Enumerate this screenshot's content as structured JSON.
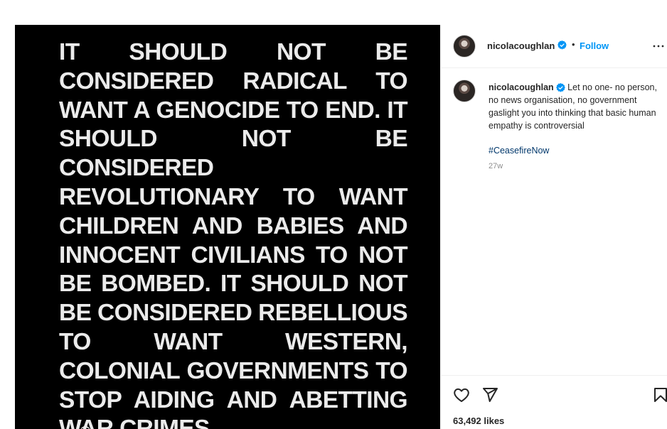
{
  "post": {
    "image_text": "It should not be considered radical to want a genocide to end. It should not be considered revolutionary to want children and babies and innocent civilians to not be bombed. It should not be considered rebellious to want western, colonial governments to stop aiding and abetting war crimes."
  },
  "header": {
    "username": "nicolacoughlan",
    "separator": "•",
    "follow_label": "Follow"
  },
  "caption": {
    "username": "nicolacoughlan",
    "text": "Let no one- no person, no news organisation, no government gaslight you into thinking that basic human empathy is controversial",
    "hashtag": "#CeasefireNow",
    "time_ago": "27w"
  },
  "actions": {
    "likes": "63,492 likes"
  },
  "icons": {
    "verified": "verified-badge-icon",
    "more": "more-options-icon",
    "like": "heart-icon",
    "share": "paper-plane-icon",
    "save": "bookmark-icon"
  },
  "colors": {
    "accent": "#0095f6",
    "hashtag": "#00376b",
    "text": "#262626",
    "muted": "#8e8e8e",
    "media_bg": "#000000",
    "media_text": "#ebebeb"
  }
}
